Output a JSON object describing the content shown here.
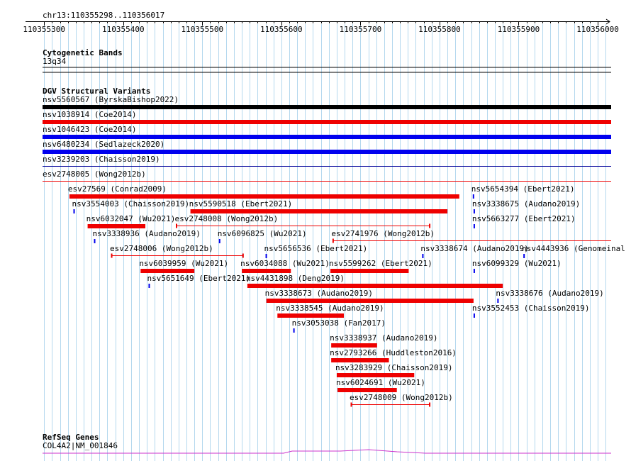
{
  "locus": "chr13:110355298..110356017",
  "ruler": {
    "start": 110355300,
    "end": 110356000,
    "ticks": [
      "110355300",
      "110355400",
      "110355500",
      "110355600",
      "110355700",
      "110355800",
      "110355900",
      "110356000"
    ]
  },
  "tracks": {
    "cytoband": {
      "title": "Cytogenetic Bands",
      "band": "13q34"
    },
    "dgv": {
      "title": "DGV Structural Variants"
    },
    "refseq": {
      "title": "RefSeq Genes",
      "gene": "COL4A2|NM_001846"
    }
  },
  "colors": {
    "loss": "#ee0000",
    "gain": "#0000ee",
    "complex": "#000000",
    "grid": "#b4d8ee",
    "gene": "#cc33cc",
    "link": "#000099"
  },
  "variants": [
    {
      "label": "nsv5560567 (ByrskaBishop2022)",
      "start": 110355298,
      "end": 110356017,
      "kind": "bar",
      "color": "complex",
      "row": 0
    },
    {
      "label": "nsv1038914 (Coe2014)",
      "start": 110355298,
      "end": 110356017,
      "kind": "bar",
      "color": "loss",
      "row": 1
    },
    {
      "label": "nsv1046423 (Coe2014)",
      "start": 110355298,
      "end": 110356017,
      "kind": "bar",
      "color": "gain",
      "row": 2
    },
    {
      "label": "nsv6480234 (Sedlazeck2020)",
      "start": 110355298,
      "end": 110356017,
      "kind": "bar",
      "color": "gain",
      "row": 3
    },
    {
      "label": "nsv3239203 (Chaisson2019)",
      "start": 110355298,
      "end": 110356017,
      "kind": "line",
      "color": "link",
      "row": 4
    },
    {
      "label": "esv2748005 (Wong2012b)",
      "start": 110355298,
      "end": 110356017,
      "kind": "line",
      "color": "loss",
      "row": 5
    },
    {
      "label": "esv27569 (Conrad2009)",
      "start": 110355332,
      "end": 110355825,
      "kind": "bar",
      "color": "loss",
      "row": 6
    },
    {
      "label": "nsv5654394 (Ebert2021)",
      "start": 110355842,
      "end": 110355843,
      "kind": "tick",
      "color": "gain",
      "row": 6
    },
    {
      "label": "nsv3554003 (Chaisson2019)",
      "start": 110355337,
      "end": 110355338,
      "kind": "tick",
      "color": "gain",
      "row": 7
    },
    {
      "label": "nsv5590518 (Ebert2021)",
      "start": 110355485,
      "end": 110355810,
      "kind": "bar",
      "color": "loss",
      "row": 7
    },
    {
      "label": "nsv3338675 (Audano2019)",
      "start": 110355843,
      "end": 110355844,
      "kind": "tick",
      "color": "gain",
      "row": 7
    },
    {
      "label": "nsv6032047 (Wu2021)",
      "start": 110355355,
      "end": 110355428,
      "kind": "bar",
      "color": "loss",
      "row": 8
    },
    {
      "label": "esv2748008 (Wong2012b)",
      "start": 110355467,
      "end": 110355788,
      "kind": "line",
      "color": "loss",
      "row": 8
    },
    {
      "label": "nsv5663277 (Ebert2021)",
      "start": 110355843,
      "end": 110355844,
      "kind": "tick",
      "color": "gain",
      "row": 8
    },
    {
      "label": "nsv3338936 (Audano2019)",
      "start": 110355363,
      "end": 110355364,
      "kind": "tick",
      "color": "gain",
      "row": 9
    },
    {
      "label": "nsv6096825 (Wu2021)",
      "start": 110355521,
      "end": 110355522,
      "kind": "tick",
      "color": "gain",
      "row": 9
    },
    {
      "label": "esv2741976 (Wong2012b)",
      "start": 110355665,
      "end": 110356017,
      "kind": "line",
      "color": "loss",
      "row": 9
    },
    {
      "label": "esv2748006 (Wong2012b)",
      "start": 110355385,
      "end": 110355552,
      "kind": "line",
      "color": "loss",
      "row": 10
    },
    {
      "label": "nsv5656536 (Ebert2021)",
      "start": 110355580,
      "end": 110355581,
      "kind": "tick",
      "color": "gain",
      "row": 10
    },
    {
      "label": "nsv3338674 (Audano2019)",
      "start": 110355778,
      "end": 110355779,
      "kind": "tick",
      "color": "gain",
      "row": 10
    },
    {
      "label": "nsv4443936 (Genomeinal",
      "start": 110355906,
      "end": 110355907,
      "kind": "tick",
      "color": "gain",
      "row": 10
    },
    {
      "label": "nsv6039959 (Wu2021)",
      "start": 110355422,
      "end": 110355490,
      "kind": "bar",
      "color": "loss",
      "row": 11
    },
    {
      "label": "nsv6034088 (Wu2021)",
      "start": 110355550,
      "end": 110355612,
      "kind": "bar",
      "color": "loss",
      "row": 11
    },
    {
      "label": "nsv5599262 (Ebert2021)",
      "start": 110355662,
      "end": 110355761,
      "kind": "bar",
      "color": "loss",
      "row": 11
    },
    {
      "label": "nsv6099329 (Wu2021)",
      "start": 110355843,
      "end": 110355844,
      "kind": "tick",
      "color": "gain",
      "row": 11
    },
    {
      "label": "nsv5651649 (Ebert2021)",
      "start": 110355432,
      "end": 110355433,
      "kind": "tick",
      "color": "gain",
      "row": 12
    },
    {
      "label": "nsv4431898 (Deng2019)",
      "start": 110355557,
      "end": 110355880,
      "kind": "bar",
      "color": "loss",
      "row": 12
    },
    {
      "label": "nsv3338673 (Audano2019)",
      "start": 110355581,
      "end": 110355843,
      "kind": "bar",
      "color": "loss",
      "row": 13
    },
    {
      "label": "nsv3338676 (Audano2019)",
      "start": 110355873,
      "end": 110355874,
      "kind": "tick",
      "color": "gain",
      "row": 13
    },
    {
      "label": "nsv3338545 (Audano2019)",
      "start": 110355595,
      "end": 110355679,
      "kind": "bar",
      "color": "loss",
      "row": 14
    },
    {
      "label": "nsv3552453 (Chaisson2019)",
      "start": 110355843,
      "end": 110355844,
      "kind": "tick",
      "color": "gain",
      "row": 14
    },
    {
      "label": "nsv3053038 (Fan2017)",
      "start": 110355615,
      "end": 110355616,
      "kind": "tick",
      "color": "gain",
      "row": 15
    },
    {
      "label": "nsv3338937 (Audano2019)",
      "start": 110355663,
      "end": 110355721,
      "kind": "bar",
      "color": "loss",
      "row": 16
    },
    {
      "label": "nsv2793266 (Huddleston2016)",
      "start": 110355663,
      "end": 110355736,
      "kind": "bar",
      "color": "loss",
      "row": 17
    },
    {
      "label": "nsv3283929 (Chaisson2019)",
      "start": 110355670,
      "end": 110355768,
      "kind": "bar",
      "color": "loss",
      "row": 18
    },
    {
      "label": "nsv6024691 (Wu2021)",
      "start": 110355671,
      "end": 110355746,
      "kind": "bar",
      "color": "loss",
      "row": 19
    },
    {
      "label": "esv2748009 (Wong2012b)",
      "start": 110355688,
      "end": 110355788,
      "kind": "line",
      "color": "loss",
      "row": 20
    }
  ]
}
